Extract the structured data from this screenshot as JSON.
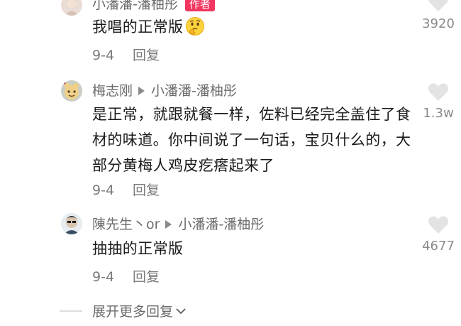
{
  "comments": [
    {
      "username": "小潘潘-潘柚彤",
      "badge": "作者",
      "text": "我唱的正常版",
      "date": "9-4",
      "reply_label": "回复",
      "likes": "3920"
    },
    {
      "username": "梅志刚",
      "reply_to": "小潘潘-潘柚彤",
      "text": "是正常，就跟就餐一样，佐料已经完全盖住了食材的味道。你中间说了一句话，宝贝什么的，大部分黄梅人鸡皮疙瘩起来了",
      "date": "9-4",
      "reply_label": "回复",
      "likes": "1.3w"
    },
    {
      "username": "陳先生丶or",
      "reply_to": "小潘潘-潘柚彤",
      "text": "抽抽的正常版",
      "date": "9-4",
      "reply_label": "回复",
      "likes": "4677"
    }
  ],
  "expand_label": "展开更多回复",
  "icons": {
    "like": "heart-icon",
    "reply_to": "reply-arrow-icon",
    "emoji": "thinking-face-emoji-icon",
    "expand": "chevron-down-icon"
  },
  "colors": {
    "badge": "#f2365f",
    "username": "#6b6b6b",
    "text": "#1a1a1a",
    "meta": "#7a7a7a",
    "heart": "#e3e3e3"
  }
}
